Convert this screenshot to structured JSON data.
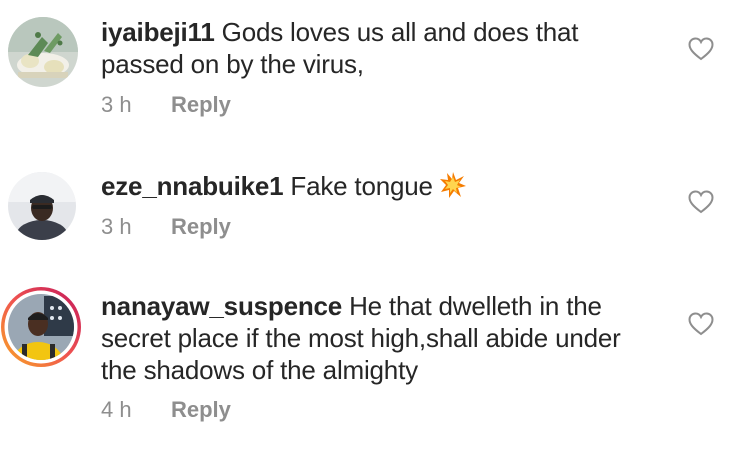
{
  "comments": [
    {
      "username": "iyaibeji11",
      "text": " Gods loves us all and does that passed on by the virus,",
      "time": "3 h",
      "reply_label": "Reply",
      "like_icon": "heart-outline-icon"
    },
    {
      "username": "eze_nnabuike1",
      "text": " Fake tongue",
      "emoji": "collision-emoji",
      "time": "3 h",
      "reply_label": "Reply",
      "like_icon": "heart-outline-icon"
    },
    {
      "username": "nanayaw_suspence",
      "text": " He that dwelleth in the secret place if the most high,shall abide under the shadows of the almighty",
      "time": "4 h",
      "reply_label": "Reply",
      "like_icon": "heart-outline-icon",
      "has_story_ring": true
    }
  ],
  "colors": {
    "text": "#262626",
    "meta": "#8e8e8e",
    "story_ring_start": "#f9a825",
    "story_ring_end": "#c2185b"
  }
}
